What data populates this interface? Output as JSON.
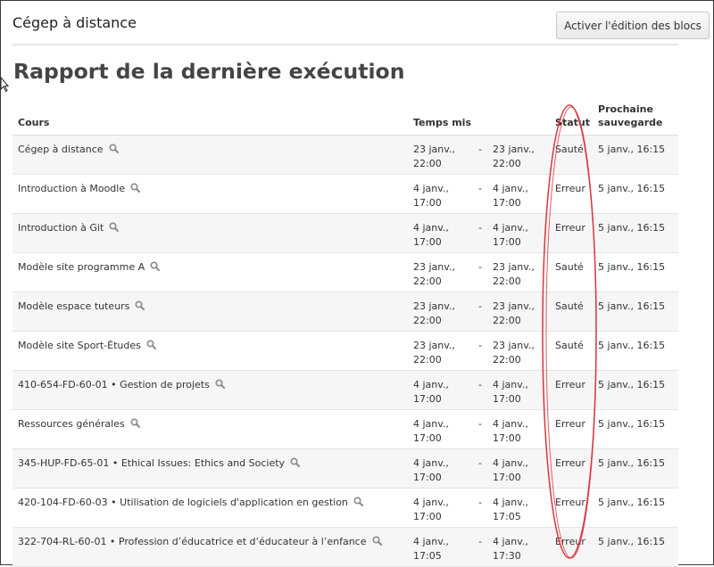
{
  "header": {
    "site_title": "Cégep à distance",
    "edit_button": "Activer l'édition des blocs"
  },
  "page_title": "Rapport de la dernière exécution",
  "table": {
    "columns": {
      "course": "Cours",
      "time": "Temps mis",
      "status": "Statut",
      "next_line1": "Prochaine",
      "next_line2": "sauvegarde"
    },
    "dash": "-",
    "rows": [
      {
        "course": "Cégep à distance",
        "start_date": "23 janv.,",
        "start_time": "22:00",
        "end_date": "23 janv.,",
        "end_time": "22:00",
        "status": "Sauté",
        "status_kind": "skipped",
        "next": "5 janv., 16:15"
      },
      {
        "course": "Introduction à Moodle",
        "start_date": "4 janv.,",
        "start_time": "17:00",
        "end_date": "4 janv.,",
        "end_time": "17:00",
        "status": "Erreur",
        "status_kind": "error",
        "next": "5 janv., 16:15"
      },
      {
        "course": "Introduction à Git",
        "start_date": "4 janv.,",
        "start_time": "17:00",
        "end_date": "4 janv.,",
        "end_time": "17:00",
        "status": "Erreur",
        "status_kind": "error",
        "next": "5 janv., 16:15"
      },
      {
        "course": "Modèle site programme A",
        "start_date": "23 janv.,",
        "start_time": "22:00",
        "end_date": "23 janv.,",
        "end_time": "22:00",
        "status": "Sauté",
        "status_kind": "skipped",
        "next": "5 janv., 16:15"
      },
      {
        "course": "Modèle espace tuteurs",
        "start_date": "23 janv.,",
        "start_time": "22:00",
        "end_date": "23 janv.,",
        "end_time": "22:00",
        "status": "Sauté",
        "status_kind": "skipped",
        "next": "5 janv., 16:15"
      },
      {
        "course": "Modèle site Sport-Études",
        "start_date": "23 janv.,",
        "start_time": "22:00",
        "end_date": "23 janv.,",
        "end_time": "22:00",
        "status": "Sauté",
        "status_kind": "skipped",
        "next": "5 janv., 16:15"
      },
      {
        "course": "410-654-FD-60-01 • Gestion de projets",
        "start_date": "4 janv.,",
        "start_time": "17:00",
        "end_date": "4 janv.,",
        "end_time": "17:00",
        "status": "Erreur",
        "status_kind": "error",
        "next": "5 janv., 16:15"
      },
      {
        "course": "Ressources générales",
        "start_date": "4 janv.,",
        "start_time": "17:00",
        "end_date": "4 janv.,",
        "end_time": "17:00",
        "status": "Erreur",
        "status_kind": "error",
        "next": "5 janv., 16:15"
      },
      {
        "course": "345-HUP-FD-65-01 • Ethical Issues: Ethics and Society",
        "start_date": "4 janv.,",
        "start_time": "17:00",
        "end_date": "4 janv.,",
        "end_time": "17:00",
        "status": "Erreur",
        "status_kind": "error",
        "next": "5 janv., 16:15"
      },
      {
        "course": "420-104-FD-60-03 • Utilisation de logiciels d'application en gestion",
        "start_date": "4 janv.,",
        "start_time": "17:00",
        "end_date": "4 janv.,",
        "end_time": "17:05",
        "status": "Erreur",
        "status_kind": "error",
        "next": "5 janv., 16:15"
      },
      {
        "course": "322-704-RL-60-01 • Profession d’éducatrice et d’éducateur à l’enfance",
        "start_date": "4 janv.,",
        "start_time": "17:05",
        "end_date": "4 janv.,",
        "end_time": "17:30",
        "status": "Erreur",
        "status_kind": "error",
        "next": "5 janv., 16:15"
      }
    ]
  },
  "colors": {
    "skipped": "#3a8a3a",
    "error": "#c0392b",
    "annotation": "#d9363e"
  },
  "icons": {
    "row_action": "magnifier-icon",
    "pointer": "mouse-cursor-icon"
  }
}
